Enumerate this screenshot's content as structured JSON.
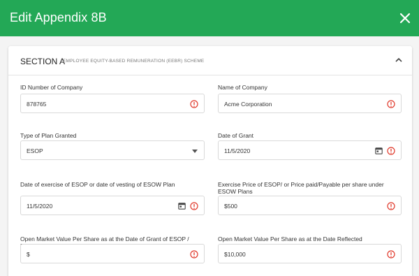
{
  "header": {
    "title": "Edit Appendix 8B",
    "close_icon": "close-icon"
  },
  "section": {
    "title": "SECTION A",
    "subtitle": "EMPLOYEE EQUITY-BASED REMUNERATION (EEBR) SCHEME",
    "toggle_icon": "chevron-up-icon"
  },
  "fields": {
    "company_id": {
      "label": "ID Number of Company",
      "value": "878765"
    },
    "company_name": {
      "label": "Name of Company",
      "value": "Acme Corporation"
    },
    "plan_type": {
      "label": "Type of Plan Granted",
      "value": "ESOP"
    },
    "grant_date": {
      "label": "Date of Grant",
      "value": "11/5/2020"
    },
    "exercise_date": {
      "label": "Date of exercise of ESOP or date of vesting of ESOW Plan",
      "value": "11/5/2020"
    },
    "exercise_price": {
      "label": "Exercise Price of ESOP/ or Price paid/Payable per share under ESOW Plans",
      "value": "$500"
    },
    "omv_grant": {
      "label": "Open Market Value Per Share as at the Date of Grant of ESOP / ESOW Plan",
      "value": "$"
    },
    "omv_reflected": {
      "label": "Open Market Value Per Share as at the Date Reflected",
      "value": "$10,000"
    }
  },
  "colors": {
    "header": "#23a856",
    "error": "#e0392b"
  }
}
